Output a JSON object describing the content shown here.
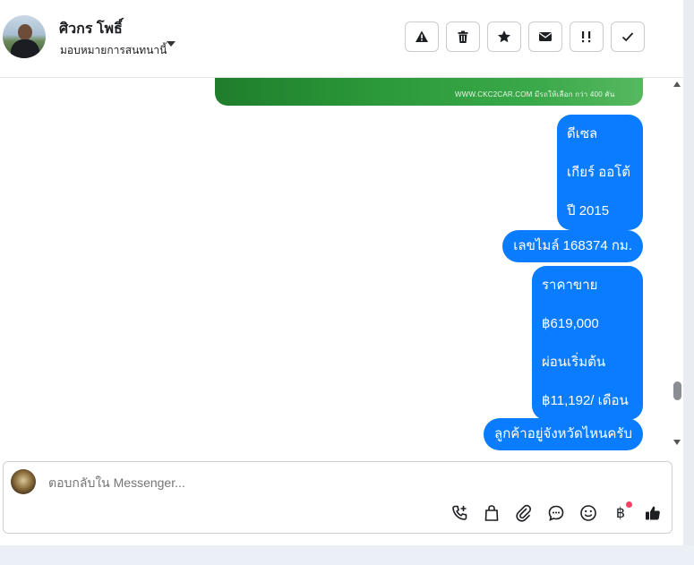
{
  "header": {
    "name": "ศิวกร โพธิ์",
    "assign_label": "มอบหมายการสนทนานี้"
  },
  "actions": [
    {
      "name": "report-spam-button",
      "icon": "warning-icon"
    },
    {
      "name": "delete-button",
      "icon": "trash-icon"
    },
    {
      "name": "star-button",
      "icon": "star-icon"
    },
    {
      "name": "mark-unread-button",
      "icon": "envelope-icon"
    },
    {
      "name": "follow-up-button",
      "icon": "follow-up-icon"
    },
    {
      "name": "mark-done-button",
      "icon": "check-icon"
    }
  ],
  "ad_banner": {
    "url_text": "WWW.CKC2CAR.COM  มีรถให้เลือก กว่า 400 คัน"
  },
  "messages": [
    {
      "lines": [
        "ดีเซล",
        "เกียร์ ออโต้",
        "ปี 2015"
      ]
    },
    {
      "lines": [
        "เลขไมล์ 168374 กม."
      ]
    },
    {
      "lines": [
        "ราคาขาย",
        "฿619,000",
        "ผ่อนเริ่มต้น",
        "฿11,192/ เดือน"
      ]
    },
    {
      "lines": [
        "ลูกค้าอยู่จังหวัดไหนครับ"
      ]
    }
  ],
  "composer": {
    "placeholder": "ตอบกลับใน Messenger...",
    "tools": [
      "phone-add-icon",
      "shopping-bag-icon",
      "paperclip-icon",
      "chat-bubble-icon",
      "emoji-icon",
      "baht-icon",
      "thumbs-up-icon"
    ],
    "baht_symbol": "฿"
  },
  "colors": {
    "bubble": "#0a7cff",
    "banner_green": "#2c9a3a",
    "notification_dot": "#f3425f"
  }
}
